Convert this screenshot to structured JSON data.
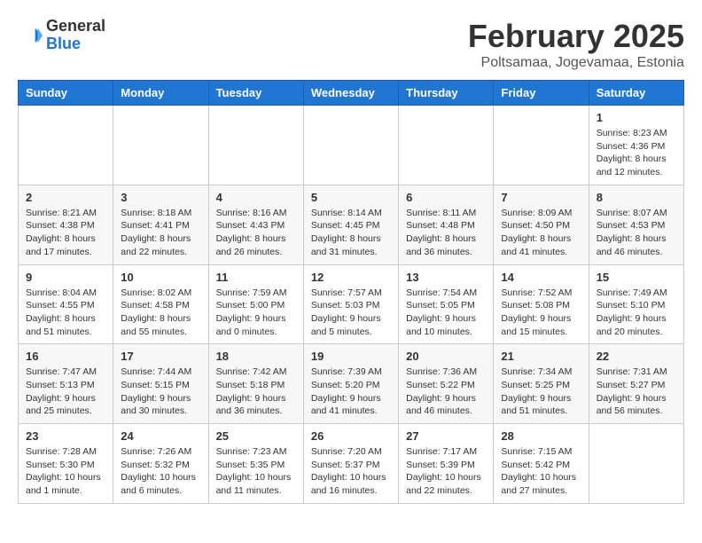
{
  "header": {
    "logo": {
      "general": "General",
      "blue": "Blue"
    },
    "title": "February 2025",
    "subtitle": "Poltsamaa, Jogevamaa, Estonia"
  },
  "calendar": {
    "weekdays": [
      "Sunday",
      "Monday",
      "Tuesday",
      "Wednesday",
      "Thursday",
      "Friday",
      "Saturday"
    ],
    "weeks": [
      [
        {
          "day": "",
          "info": ""
        },
        {
          "day": "",
          "info": ""
        },
        {
          "day": "",
          "info": ""
        },
        {
          "day": "",
          "info": ""
        },
        {
          "day": "",
          "info": ""
        },
        {
          "day": "",
          "info": ""
        },
        {
          "day": "1",
          "info": "Sunrise: 8:23 AM\nSunset: 4:36 PM\nDaylight: 8 hours and 12 minutes."
        }
      ],
      [
        {
          "day": "2",
          "info": "Sunrise: 8:21 AM\nSunset: 4:38 PM\nDaylight: 8 hours and 17 minutes."
        },
        {
          "day": "3",
          "info": "Sunrise: 8:18 AM\nSunset: 4:41 PM\nDaylight: 8 hours and 22 minutes."
        },
        {
          "day": "4",
          "info": "Sunrise: 8:16 AM\nSunset: 4:43 PM\nDaylight: 8 hours and 26 minutes."
        },
        {
          "day": "5",
          "info": "Sunrise: 8:14 AM\nSunset: 4:45 PM\nDaylight: 8 hours and 31 minutes."
        },
        {
          "day": "6",
          "info": "Sunrise: 8:11 AM\nSunset: 4:48 PM\nDaylight: 8 hours and 36 minutes."
        },
        {
          "day": "7",
          "info": "Sunrise: 8:09 AM\nSunset: 4:50 PM\nDaylight: 8 hours and 41 minutes."
        },
        {
          "day": "8",
          "info": "Sunrise: 8:07 AM\nSunset: 4:53 PM\nDaylight: 8 hours and 46 minutes."
        }
      ],
      [
        {
          "day": "9",
          "info": "Sunrise: 8:04 AM\nSunset: 4:55 PM\nDaylight: 8 hours and 51 minutes."
        },
        {
          "day": "10",
          "info": "Sunrise: 8:02 AM\nSunset: 4:58 PM\nDaylight: 8 hours and 55 minutes."
        },
        {
          "day": "11",
          "info": "Sunrise: 7:59 AM\nSunset: 5:00 PM\nDaylight: 9 hours and 0 minutes."
        },
        {
          "day": "12",
          "info": "Sunrise: 7:57 AM\nSunset: 5:03 PM\nDaylight: 9 hours and 5 minutes."
        },
        {
          "day": "13",
          "info": "Sunrise: 7:54 AM\nSunset: 5:05 PM\nDaylight: 9 hours and 10 minutes."
        },
        {
          "day": "14",
          "info": "Sunrise: 7:52 AM\nSunset: 5:08 PM\nDaylight: 9 hours and 15 minutes."
        },
        {
          "day": "15",
          "info": "Sunrise: 7:49 AM\nSunset: 5:10 PM\nDaylight: 9 hours and 20 minutes."
        }
      ],
      [
        {
          "day": "16",
          "info": "Sunrise: 7:47 AM\nSunset: 5:13 PM\nDaylight: 9 hours and 25 minutes."
        },
        {
          "day": "17",
          "info": "Sunrise: 7:44 AM\nSunset: 5:15 PM\nDaylight: 9 hours and 30 minutes."
        },
        {
          "day": "18",
          "info": "Sunrise: 7:42 AM\nSunset: 5:18 PM\nDaylight: 9 hours and 36 minutes."
        },
        {
          "day": "19",
          "info": "Sunrise: 7:39 AM\nSunset: 5:20 PM\nDaylight: 9 hours and 41 minutes."
        },
        {
          "day": "20",
          "info": "Sunrise: 7:36 AM\nSunset: 5:22 PM\nDaylight: 9 hours and 46 minutes."
        },
        {
          "day": "21",
          "info": "Sunrise: 7:34 AM\nSunset: 5:25 PM\nDaylight: 9 hours and 51 minutes."
        },
        {
          "day": "22",
          "info": "Sunrise: 7:31 AM\nSunset: 5:27 PM\nDaylight: 9 hours and 56 minutes."
        }
      ],
      [
        {
          "day": "23",
          "info": "Sunrise: 7:28 AM\nSunset: 5:30 PM\nDaylight: 10 hours and 1 minute."
        },
        {
          "day": "24",
          "info": "Sunrise: 7:26 AM\nSunset: 5:32 PM\nDaylight: 10 hours and 6 minutes."
        },
        {
          "day": "25",
          "info": "Sunrise: 7:23 AM\nSunset: 5:35 PM\nDaylight: 10 hours and 11 minutes."
        },
        {
          "day": "26",
          "info": "Sunrise: 7:20 AM\nSunset: 5:37 PM\nDaylight: 10 hours and 16 minutes."
        },
        {
          "day": "27",
          "info": "Sunrise: 7:17 AM\nSunset: 5:39 PM\nDaylight: 10 hours and 22 minutes."
        },
        {
          "day": "28",
          "info": "Sunrise: 7:15 AM\nSunset: 5:42 PM\nDaylight: 10 hours and 27 minutes."
        },
        {
          "day": "",
          "info": ""
        }
      ]
    ]
  }
}
